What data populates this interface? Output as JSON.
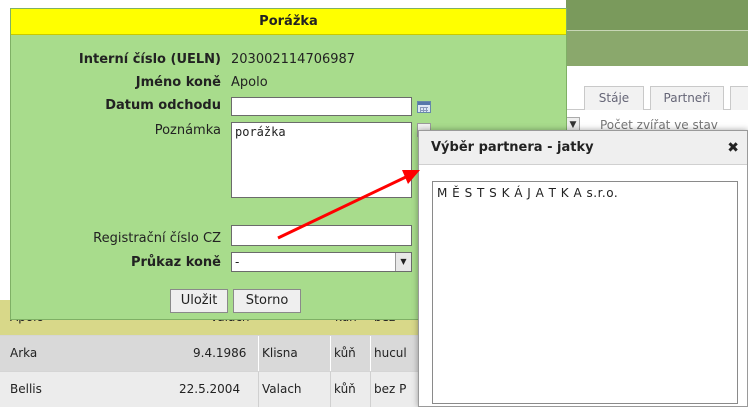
{
  "background": {
    "tabs": [
      "Stáje",
      "Partneři"
    ],
    "toolbar_text": "Počet zvířat ve stav",
    "rows": [
      {
        "name": "Apolo",
        "date": "…",
        "type": "Valach",
        "sex": "kůň",
        "breed": "bez"
      },
      {
        "name": "Arka",
        "date": "9.4.1986",
        "type": "Klisna",
        "sex": "kůň",
        "breed": "hucul"
      },
      {
        "name": "Bellis",
        "date": "22.5.2004",
        "type": "Valach",
        "sex": "kůň",
        "breed": "bez P"
      }
    ]
  },
  "dialog": {
    "title": "Porážka",
    "fields": {
      "ueln_label": "Interní číslo (UELN)",
      "ueln_value": "203002114706987",
      "name_label": "Jméno koně",
      "name_value": "Apolo",
      "departure_label": "Datum odchodu",
      "departure_value": "",
      "note_label": "Poznámka",
      "note_value": "porážka",
      "reg_label": "Registrační číslo CZ",
      "reg_value": "",
      "passport_label": "Průkaz koně",
      "passport_value": "-"
    },
    "buttons": {
      "save": "Uložit",
      "cancel": "Storno"
    }
  },
  "popup": {
    "title": "Výběr partnera - jatky",
    "close_symbol": "✖",
    "items": [
      "M Ě S T S K Á J A T K A s.r.o."
    ]
  },
  "colors": {
    "dialog_bg": "#a8dc8c",
    "title_bg": "#ffff00",
    "arrow": "#ff0000"
  }
}
